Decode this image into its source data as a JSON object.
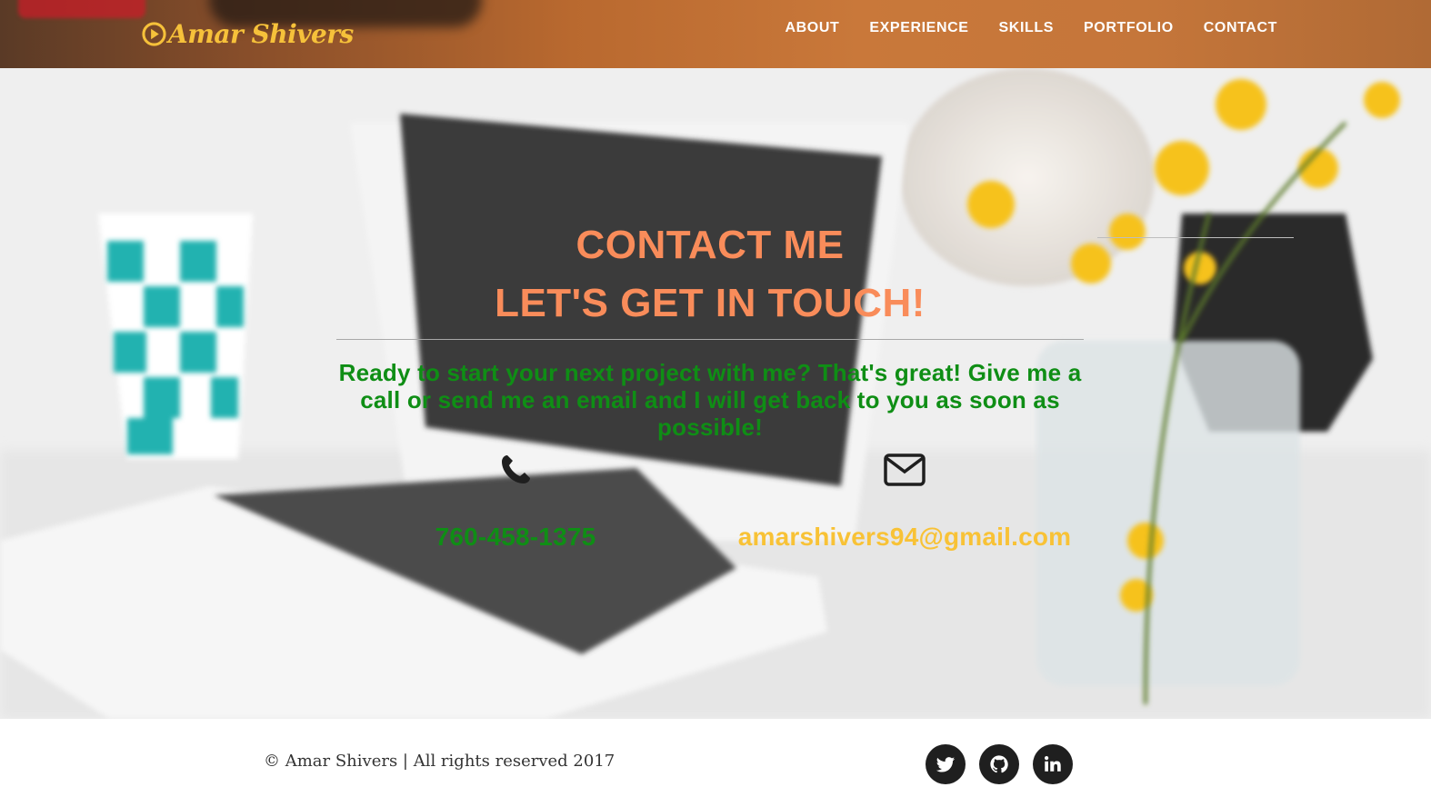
{
  "navbar": {
    "brand": "Amar Shivers",
    "brand_icon": "play-circle-icon",
    "links": [
      "ABOUT",
      "EXPERIENCE",
      "SKILLS",
      "PORTFOLIO",
      "CONTACT"
    ]
  },
  "hero": {
    "heading_line1": "CONTACT ME",
    "heading_line2": "LET'S GET IN TOUCH!",
    "lead": "Ready to start your next project with me? That's great! Give me a call or send me an email and I will get back to you as soon as possible!",
    "phone": {
      "icon": "phone-icon",
      "value": "760-458-1375"
    },
    "email": {
      "icon": "envelope-icon",
      "value": "amarshivers94@gmail.com"
    }
  },
  "footer": {
    "copyright": "© Amar Shivers | All rights reserved 2017",
    "social": [
      {
        "name": "twitter",
        "icon": "twitter-icon"
      },
      {
        "name": "github",
        "icon": "github-icon"
      },
      {
        "name": "linkedin",
        "icon": "linkedin-icon"
      }
    ]
  },
  "colors": {
    "brand": "#f6c13a",
    "heading": "#f98c5a",
    "lead": "#0f8e15",
    "phone": "#0f8e15",
    "email": "#f8c236",
    "social_bg": "#1f1f1f"
  }
}
